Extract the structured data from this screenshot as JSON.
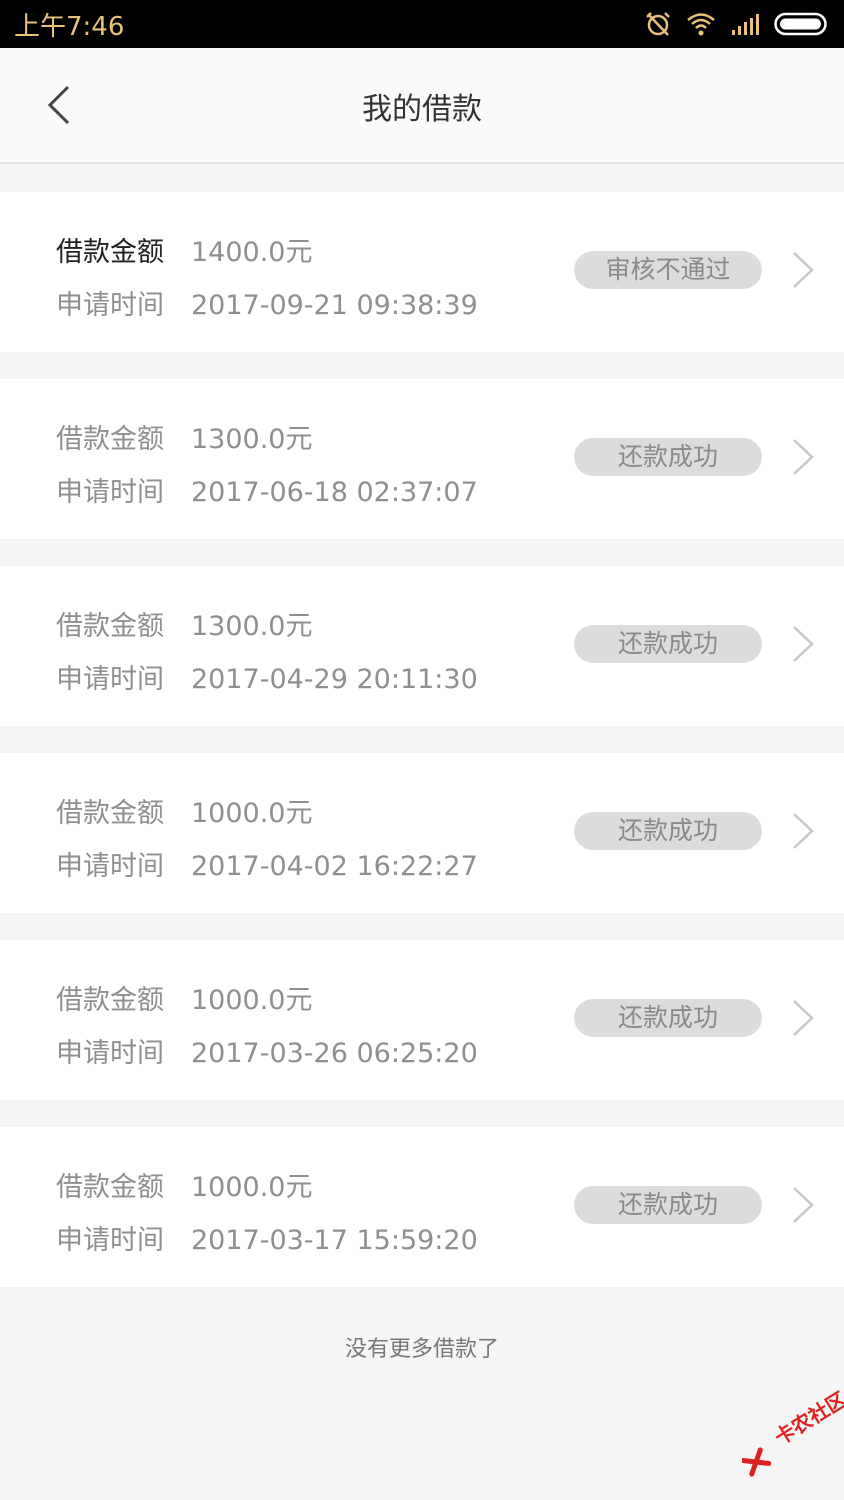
{
  "status_bar": {
    "time": "上午7:46"
  },
  "header": {
    "title": "我的借款"
  },
  "labels": {
    "amount": "借款金额",
    "time": "申请时间"
  },
  "loans": [
    {
      "amount": "1400.0元",
      "time": "2017-09-21  09:38:39",
      "status": "审核不通过"
    },
    {
      "amount": "1300.0元",
      "time": "2017-06-18  02:37:07",
      "status": "还款成功"
    },
    {
      "amount": "1300.0元",
      "time": "2017-04-29  20:11:30",
      "status": "还款成功"
    },
    {
      "amount": "1000.0元",
      "time": "2017-04-02  16:22:27",
      "status": "还款成功"
    },
    {
      "amount": "1000.0元",
      "time": "2017-03-26  06:25:20",
      "status": "还款成功"
    },
    {
      "amount": "1000.0元",
      "time": "2017-03-17  15:59:20",
      "status": "还款成功"
    }
  ],
  "footer": {
    "text": "没有更多借款了"
  },
  "watermark": {
    "text": "卡农社区"
  },
  "colors": {
    "status_bar_bg": "#000000",
    "status_text": "#e8c27a",
    "pill_bg": "#dcdcdc",
    "watermark": "#dd2222"
  }
}
